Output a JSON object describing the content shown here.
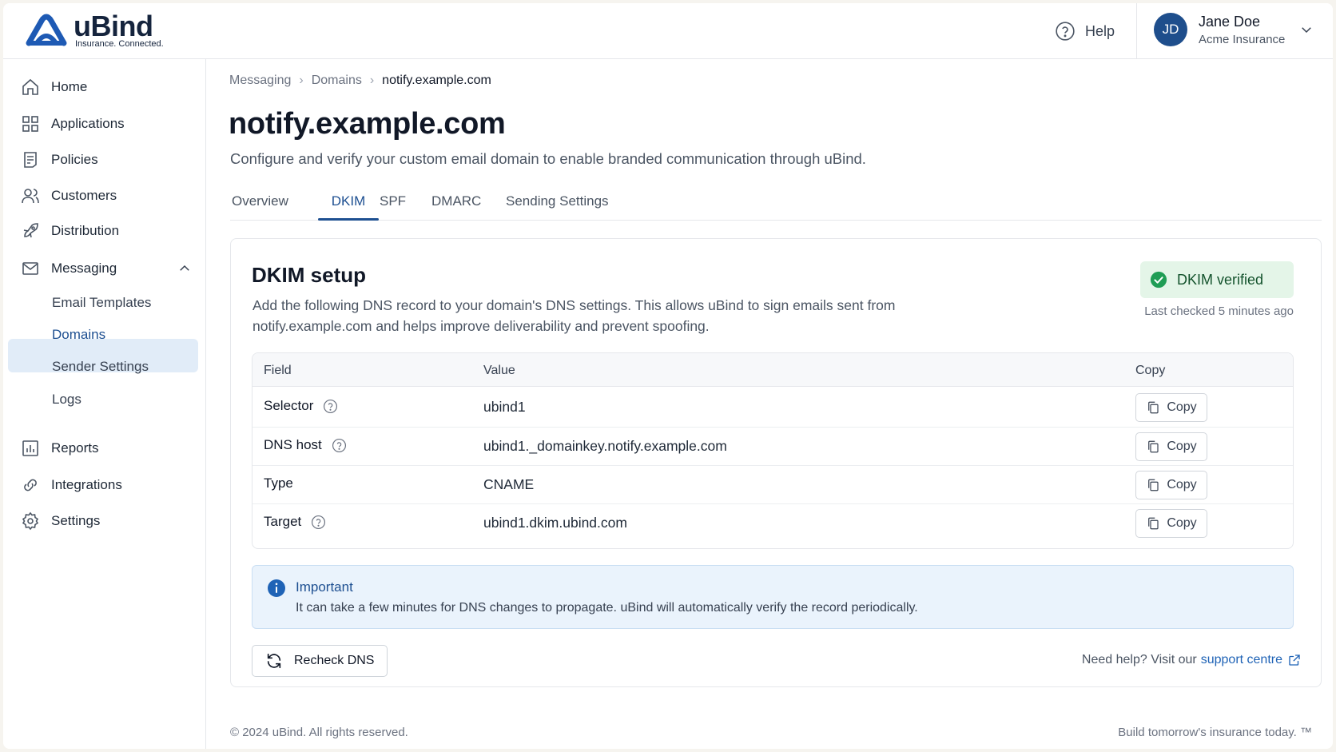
{
  "brand": {
    "name": "uBind",
    "tagline": "Insurance. Connected.",
    "color": "#1e5ab4"
  },
  "topbar": {
    "help_label": "Help",
    "user": {
      "initials": "JD",
      "name": "Jane Doe",
      "org": "Acme Insurance"
    }
  },
  "sidebar": {
    "items": [
      {
        "label": "Home",
        "icon": "home-icon"
      },
      {
        "label": "Applications",
        "icon": "grid-icon"
      },
      {
        "label": "Policies",
        "icon": "document-icon"
      },
      {
        "label": "Customers",
        "icon": "users-icon"
      },
      {
        "label": "Distribution",
        "icon": "rocket-icon"
      },
      {
        "label": "Messaging",
        "icon": "mail-icon",
        "expanded": true
      },
      {
        "label": "Reports",
        "icon": "chart-icon"
      },
      {
        "label": "Integrations",
        "icon": "link-icon"
      },
      {
        "label": "Settings",
        "icon": "gear-icon"
      }
    ],
    "messaging_sub": [
      {
        "label": "Email Templates"
      },
      {
        "label": "Domains",
        "active": true
      },
      {
        "label": "Sender Settings"
      },
      {
        "label": "Logs"
      }
    ]
  },
  "breadcrumb": [
    "Messaging",
    "Domains",
    "notify.example.com"
  ],
  "page": {
    "title": "notify.example.com",
    "subtitle": "Configure and verify your custom email domain to enable branded communication through uBind."
  },
  "tabs": [
    {
      "label": "Overview"
    },
    {
      "label": "DKIM",
      "active": true
    },
    {
      "label": "SPF"
    },
    {
      "label": "DMARC"
    },
    {
      "label": "Sending Settings"
    }
  ],
  "dkim": {
    "title": "DKIM setup",
    "description": "Add the following DNS record to your domain's DNS settings. This allows uBind to sign emails sent from notify.example.com and helps improve deliverability and prevent spoofing.",
    "status": "DKIM verified",
    "status_color": "#1f9d55",
    "last_checked": "Last checked 5 minutes ago",
    "table": {
      "headers": [
        "Field",
        "Value",
        "Copy"
      ],
      "rows": [
        {
          "field": "Selector",
          "value": "ubind1",
          "help": true,
          "copy": "Copy"
        },
        {
          "field": "DNS host",
          "value": "ubind1._domainkey.notify.example.com",
          "help": true,
          "copy": "Copy"
        },
        {
          "field": "Type",
          "value": "CNAME",
          "help": false,
          "copy": "Copy"
        },
        {
          "field": "Target",
          "value": "ubind1.dkim.ubind.com",
          "help": true,
          "copy": "Copy"
        }
      ]
    },
    "info": {
      "title": "Important",
      "text": "It can take a few minutes for DNS changes to propagate. uBind will automatically verify the record periodically."
    },
    "recheck_label": "Recheck DNS",
    "support_prefix": "Need help? Visit our",
    "support_link": "support centre"
  },
  "footer": {
    "copyright": "© 2024 uBind. All rights reserved.",
    "slogan": "Build tomorrow's insurance today. ™"
  }
}
